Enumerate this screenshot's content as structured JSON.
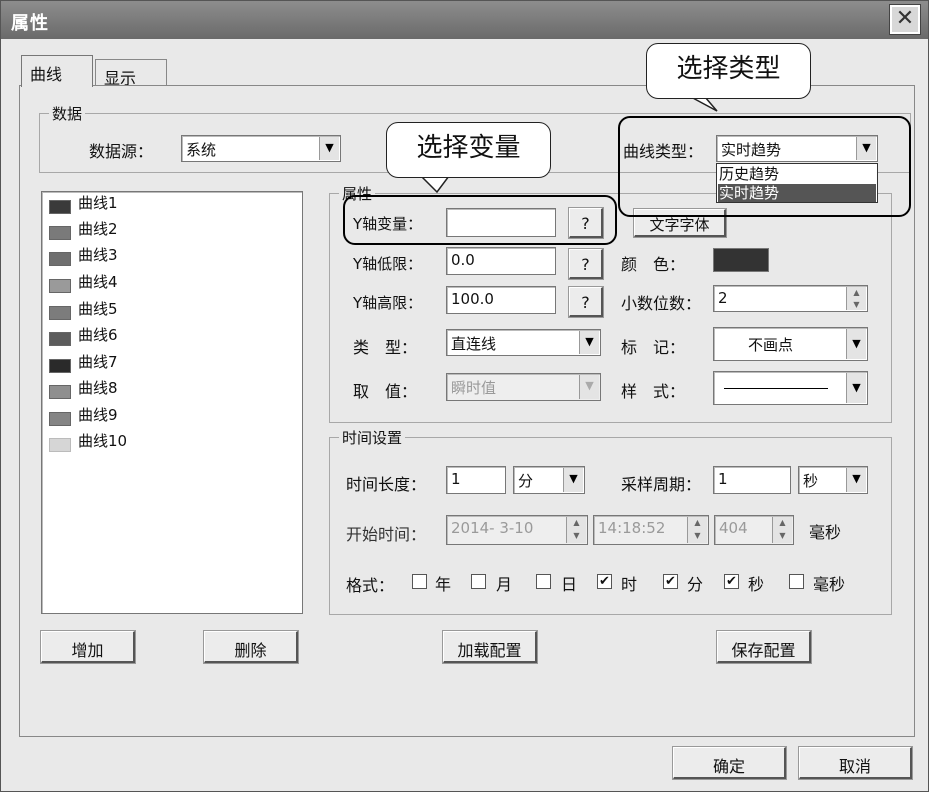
{
  "window": {
    "title": "属性",
    "close_symbol": "✕"
  },
  "tabs": [
    {
      "label": "曲线"
    },
    {
      "label": "显示"
    }
  ],
  "data_group": {
    "title": "数据",
    "source_label": "数据源：",
    "source_value": "系统",
    "curve_type_label": "曲线类型：",
    "curve_type_value": "实时趋势",
    "curve_type_options": [
      "历史趋势",
      "实时趋势"
    ]
  },
  "curves": [
    {
      "label": "曲线1",
      "color": "#3a3a3a"
    },
    {
      "label": "曲线2",
      "color": "#7a7a7a"
    },
    {
      "label": "曲线3",
      "color": "#6f6f6f"
    },
    {
      "label": "曲线4",
      "color": "#9a9a9a"
    },
    {
      "label": "曲线5",
      "color": "#7c7c7c"
    },
    {
      "label": "曲线6",
      "color": "#5c5c5c"
    },
    {
      "label": "曲线7",
      "color": "#2a2a2a"
    },
    {
      "label": "曲线8",
      "color": "#8f8f8f"
    },
    {
      "label": "曲线9",
      "color": "#858585"
    },
    {
      "label": "曲线10",
      "color": "#d6d6d6"
    }
  ],
  "attributes": {
    "title": "属性",
    "y_var_label": "Y轴变量：",
    "y_var_value": "",
    "y_low_label": "Y轴低限：",
    "y_low_value": "0.0",
    "y_high_label": "Y轴高限：",
    "y_high_value": "100.0",
    "question_label": "?",
    "type_label": "类　型：",
    "type_value": "直连线",
    "value_label": "取　值：",
    "value_value": "瞬时值",
    "font_button": "文字字体",
    "color_label": "颜　色：",
    "color_value": "#333333",
    "decimal_label": "小数位数：",
    "decimal_value": "2",
    "mark_label": "标　记：",
    "mark_value": "不画点",
    "style_label": "样　式："
  },
  "time_group": {
    "title": "时间设置",
    "length_label": "时间长度：",
    "length_value": "1",
    "length_unit": "分",
    "period_label": "采样周期：",
    "period_value": "1",
    "period_unit": "秒",
    "start_label": "开始时间：",
    "start_date": "2014- 3-10",
    "start_time": "14:18:52",
    "start_ms": "404",
    "ms_unit": "毫秒",
    "format_label": "格式：",
    "format_items": [
      {
        "label": "年",
        "checked": false
      },
      {
        "label": "月",
        "checked": false
      },
      {
        "label": "日",
        "checked": false
      },
      {
        "label": "时",
        "checked": true
      },
      {
        "label": "分",
        "checked": true
      },
      {
        "label": "秒",
        "checked": true
      },
      {
        "label": "毫秒",
        "checked": false
      }
    ]
  },
  "buttons": {
    "add": "增加",
    "delete": "删除",
    "load_config": "加载配置",
    "save_config": "保存配置",
    "ok": "确定",
    "cancel": "取消"
  },
  "annotations": {
    "select_type": "选择类型",
    "select_var": "选择变量"
  }
}
